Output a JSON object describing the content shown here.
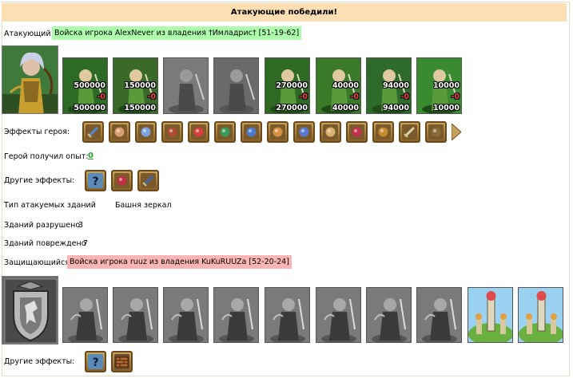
{
  "banner": "Атакующие победили!",
  "attacker": {
    "label": "Атакующий",
    "tag": "Войска игрока AlexNever из владения †Имладрис† [51-19-62]",
    "units": [
      {
        "icon": "elf-knight-icon",
        "count": "500000",
        "loss": "-0",
        "remaining": "500000"
      },
      {
        "icon": "elf-swordsman-icon",
        "count": "150000",
        "loss": "-0",
        "remaining": "150000"
      },
      {
        "icon": "empty-unit-icon",
        "count": "",
        "loss": "",
        "remaining": ""
      },
      {
        "icon": "empty-griffin-icon",
        "count": "",
        "loss": "",
        "remaining": ""
      },
      {
        "icon": "elf-archer-icon",
        "count": "270000",
        "loss": "-0",
        "remaining": "270000"
      },
      {
        "icon": "dryad-icon",
        "count": "40000",
        "loss": "-0",
        "remaining": "40000"
      },
      {
        "icon": "elf-ranger-icon",
        "count": "94000",
        "loss": "-0",
        "remaining": "94000"
      },
      {
        "icon": "druid-icon",
        "count": "10000",
        "loss": "-0",
        "remaining": "10000"
      }
    ]
  },
  "hero_effects": {
    "label": "Эффекты героя:",
    "icons": [
      "sword-icon",
      "handshake-icon",
      "hand-icon",
      "chest-icon",
      "dice-icon",
      "shield-green-icon",
      "shield-hand-icon",
      "fist-icon",
      "snowflake-icon",
      "scroll-icon",
      "ring-icon",
      "horn-icon",
      "dagger-icon",
      "armor-icon",
      "arrow-right-icon"
    ]
  },
  "experience": {
    "label": "Герой получил опыт:",
    "value": "0"
  },
  "other_effects_attacker": {
    "label": "Другие эффекты:",
    "icons": [
      "question-icon",
      "heart-shield-icon",
      "blue-sword-icon"
    ]
  },
  "buildings": {
    "type_label": "Тип атакуемых зданий",
    "type_value": "Башня зеркал",
    "destroyed_label": "Зданий разрушено",
    "destroyed_value": "3",
    "damaged_label": "Зданий повреждено",
    "damaged_value": "7"
  },
  "defender": {
    "label": "Защищающийся",
    "tag": "Войска игрока ruuz из владения KuKuRUUZa [52-20-24]",
    "units": [
      "knight-icon",
      "swordsman-icon",
      "cavalry-icon",
      "pegasus-icon",
      "crossbowman-icon",
      "monk-icon",
      "heavy-knight-icon",
      "reaper-icon",
      "mirror-tower-icon",
      "mirror-tower-icon"
    ]
  },
  "other_effects_defender": {
    "label": "Другие эффекты:",
    "icons": [
      "question-icon",
      "wall-icon"
    ]
  },
  "colors": {
    "banner": "#fddfb3",
    "attacker_tag": "#adfdad",
    "defender_tag": "#f9b4b4",
    "exp_link": "#24a424",
    "loss": "#ff4040"
  }
}
